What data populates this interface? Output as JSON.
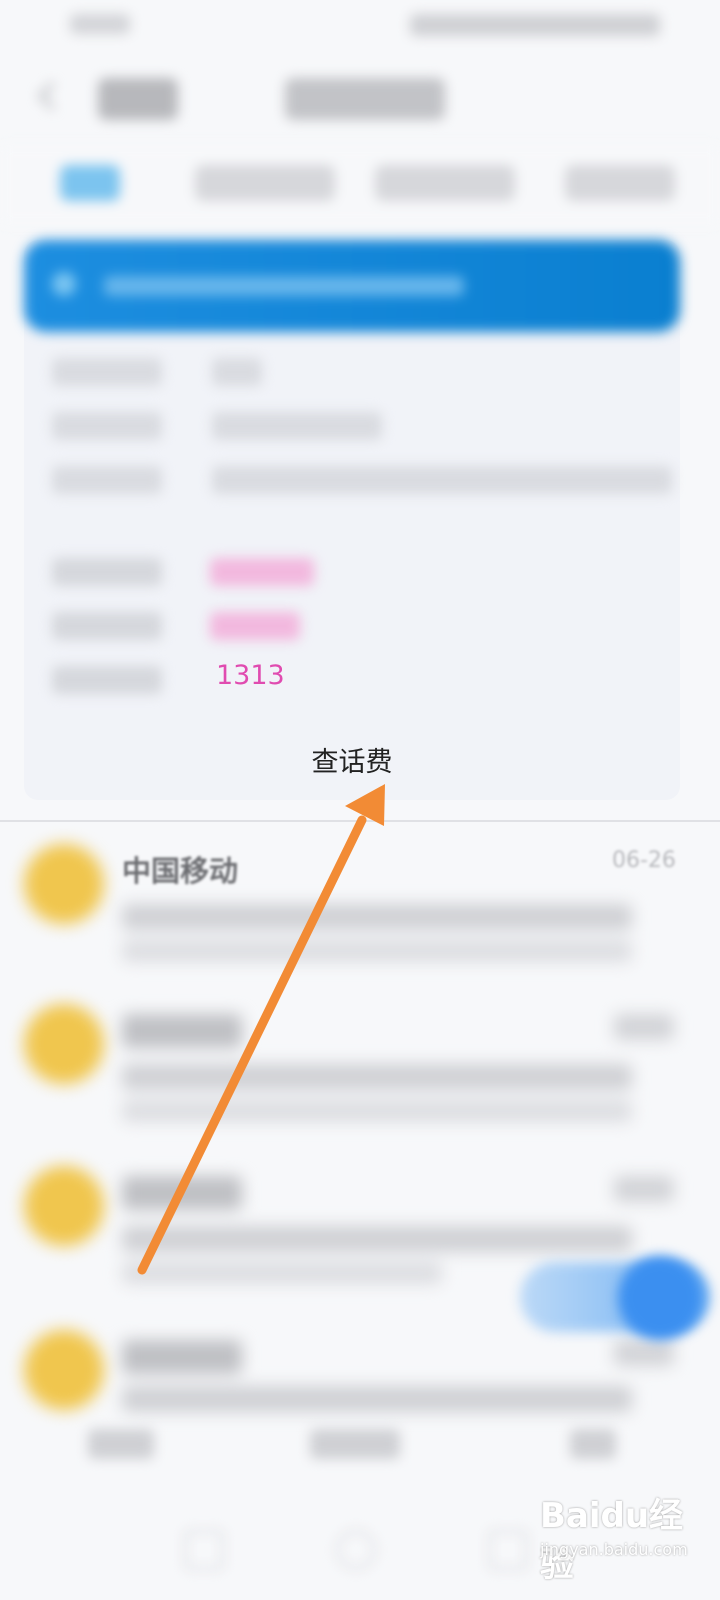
{
  "fee_summary": {
    "balance_value": "1313",
    "query_label": "查话费"
  },
  "messages": [
    {
      "sender": "中国移动",
      "date": "06-26"
    }
  ],
  "watermark": {
    "logo_text": "Baidu经验",
    "subtitle": "jingyan.baidu.com"
  },
  "colors": {
    "banner": "#0a7fd0",
    "fee_pink": "#e04bb0",
    "avatar": "#f0c64e",
    "arrow": "#f28b35",
    "fab": "#3b8ff0"
  },
  "icons": {
    "back": "chevron-left-icon",
    "banner": "info-icon"
  }
}
